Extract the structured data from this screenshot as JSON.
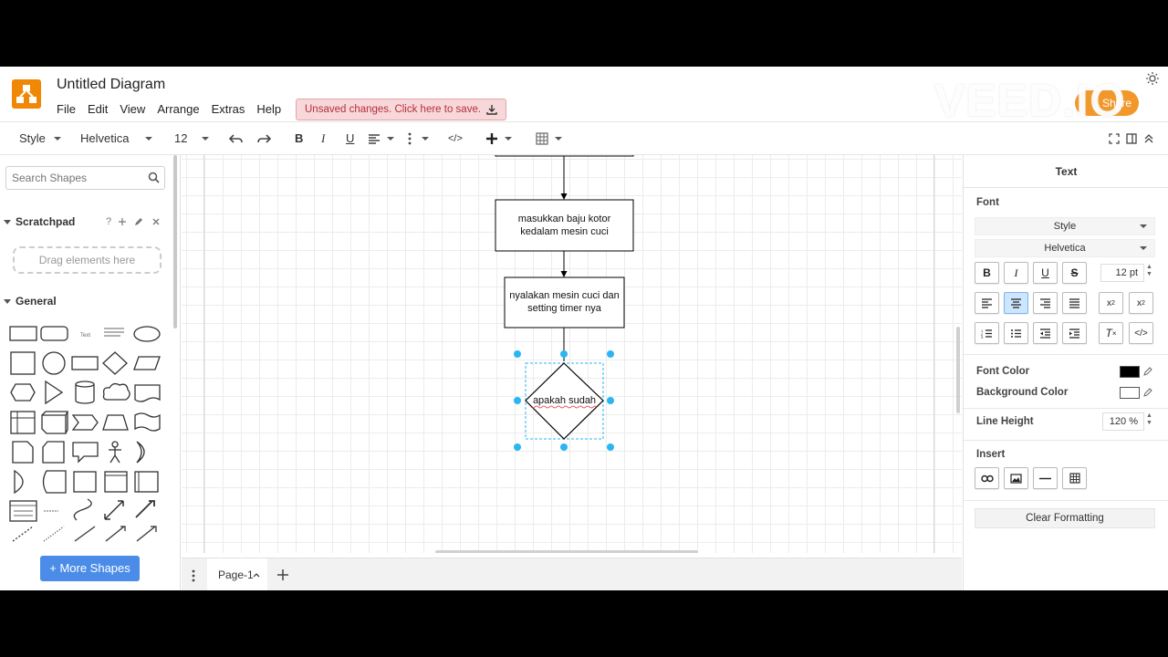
{
  "app": {
    "title": "Untitled Diagram",
    "menu": [
      "File",
      "Edit",
      "View",
      "Arrange",
      "Extras",
      "Help"
    ],
    "save_banner": "Unsaved changes. Click here to save.",
    "share_label": "Share",
    "watermark": "VEED.IO"
  },
  "toolbar": {
    "style_label": "Style",
    "font_label": "Helvetica",
    "size_label": "12",
    "bold": "B",
    "italic": "I",
    "underline": "U",
    "html": "</>"
  },
  "left_panel": {
    "search_placeholder": "Search Shapes",
    "scratchpad_title": "Scratchpad",
    "scratchpad_help": "?",
    "drop_zone": "Drag elements here",
    "general_title": "General",
    "more_shapes": "+ More Shapes"
  },
  "diagram": {
    "nodes": [
      {
        "id": "process1",
        "text_line1": "masukkan baju kotor",
        "text_line2": "kedalam mesin cuci"
      },
      {
        "id": "process2",
        "text_line1": "nyalakan mesin cuci dan",
        "text_line2": "setting timer nya"
      },
      {
        "id": "decision",
        "text": "apakah sudah"
      }
    ]
  },
  "bottom": {
    "page_tab": "Page-1"
  },
  "right_panel": {
    "title": "Text",
    "font_section": "Font",
    "style_select": "Style",
    "font_select": "Helvetica",
    "font_size": "12 pt",
    "font_color_label": "Font Color",
    "bg_color_label": "Background Color",
    "line_height_label": "Line Height",
    "line_height_value": "120 %",
    "insert_section": "Insert",
    "clear_formatting": "Clear Formatting",
    "colors": {
      "font_color": "#000000",
      "bg_color": "#ffffff",
      "active_button": "#cde6ff"
    }
  },
  "colors": {
    "brand": "#f08705",
    "accent": "#4a8ce8",
    "banner_bg": "#f8d7da",
    "selection": "#29b6f2"
  }
}
